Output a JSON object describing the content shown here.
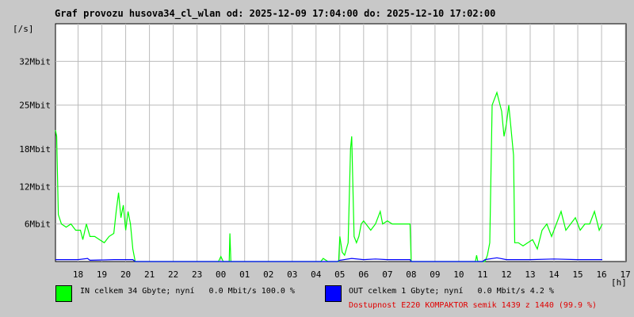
{
  "title": "Graf provozu husova34_cl_wlan od: 2025-12-09 17:04:00 do: 2025-12-10 17:02:00",
  "legend": {
    "in_label": "IN celkem 34 Gbyte; nyní   0.0 Mbit/s 100.0 %",
    "out_label": "OUT celkem 1 Gbyte; nyní   0.0 Mbit/s 4.2 %",
    "in_color": "#00ff00",
    "out_color": "#0000ff"
  },
  "availability": "Dostupnost E220 KOMPAKTOR semik 1439 z 1440 (99.9 %)",
  "chart_data": {
    "type": "line",
    "title": "Graf provozu husova34_cl_wlan od: 2025-12-09 17:04:00 do: 2025-12-10 17:02:00",
    "ylabel": "[/s]",
    "xlabel": "[h]",
    "grid": true,
    "ylim": [
      0,
      38
    ],
    "y_ticks": [
      {
        "value": 6,
        "label": "6Mbit"
      },
      {
        "value": 12,
        "label": "12Mbit"
      },
      {
        "value": 18,
        "label": "18Mbit"
      },
      {
        "value": 25,
        "label": "25Mbit"
      },
      {
        "value": 32,
        "label": "32Mbit"
      }
    ],
    "x_range": [
      17.05,
      17.03
    ],
    "x_tick_labels": [
      "18",
      "19",
      "20",
      "21",
      "22",
      "23",
      "00",
      "01",
      "02",
      "03",
      "04",
      "05",
      "06",
      "07",
      "08",
      "09",
      "10",
      "11",
      "12",
      "13",
      "14",
      "15",
      "16",
      "17"
    ],
    "series": [
      {
        "name": "IN",
        "color": "#00ff00",
        "points": [
          [
            17.05,
            21
          ],
          [
            17.1,
            20
          ],
          [
            17.17,
            7.5
          ],
          [
            17.3,
            6
          ],
          [
            17.5,
            5.5
          ],
          [
            17.7,
            6
          ],
          [
            17.9,
            5
          ],
          [
            18.1,
            5
          ],
          [
            18.2,
            3.5
          ],
          [
            18.35,
            6
          ],
          [
            18.5,
            4
          ],
          [
            18.7,
            4
          ],
          [
            18.9,
            3.5
          ],
          [
            19.1,
            3
          ],
          [
            19.3,
            4
          ],
          [
            19.5,
            4.5
          ],
          [
            19.6,
            8
          ],
          [
            19.7,
            11
          ],
          [
            19.8,
            7
          ],
          [
            19.9,
            9
          ],
          [
            20.0,
            5
          ],
          [
            20.1,
            8
          ],
          [
            20.2,
            6
          ],
          [
            20.3,
            2
          ],
          [
            20.4,
            0
          ],
          [
            21.0,
            0
          ],
          [
            22.0,
            0
          ],
          [
            23.0,
            0
          ],
          [
            23.9,
            0
          ],
          [
            24.0,
            0.8
          ],
          [
            24.1,
            0
          ],
          [
            24.35,
            0
          ],
          [
            24.38,
            4.5
          ],
          [
            24.42,
            0
          ],
          [
            25.0,
            0
          ],
          [
            27.0,
            0
          ],
          [
            28.2,
            0
          ],
          [
            28.3,
            0.5
          ],
          [
            28.5,
            0
          ],
          [
            28.95,
            0
          ],
          [
            29.0,
            4
          ],
          [
            29.1,
            1.5
          ],
          [
            29.2,
            1
          ],
          [
            29.35,
            3
          ],
          [
            29.45,
            18
          ],
          [
            29.5,
            20
          ],
          [
            29.55,
            12
          ],
          [
            29.6,
            4
          ],
          [
            29.7,
            3
          ],
          [
            29.8,
            4
          ],
          [
            29.9,
            6
          ],
          [
            30.0,
            6.5
          ],
          [
            30.1,
            6
          ],
          [
            30.3,
            5
          ],
          [
            30.5,
            6
          ],
          [
            30.7,
            8
          ],
          [
            30.8,
            6
          ],
          [
            31.0,
            6.5
          ],
          [
            31.2,
            6
          ],
          [
            31.5,
            6
          ],
          [
            31.7,
            6
          ],
          [
            31.95,
            6
          ],
          [
            32.0,
            0
          ],
          [
            33.0,
            0
          ],
          [
            34.0,
            0
          ],
          [
            34.7,
            0
          ],
          [
            34.75,
            1
          ],
          [
            34.8,
            0
          ],
          [
            35.1,
            0
          ],
          [
            35.2,
            1
          ],
          [
            35.3,
            3
          ],
          [
            35.4,
            25
          ],
          [
            35.6,
            27
          ],
          [
            35.8,
            24
          ],
          [
            35.9,
            20
          ],
          [
            36.0,
            22
          ],
          [
            36.1,
            25
          ],
          [
            36.2,
            21
          ],
          [
            36.3,
            17
          ],
          [
            36.35,
            3
          ],
          [
            36.5,
            3
          ],
          [
            36.7,
            2.5
          ],
          [
            36.9,
            3
          ],
          [
            37.1,
            3.5
          ],
          [
            37.3,
            2
          ],
          [
            37.5,
            5
          ],
          [
            37.7,
            6
          ],
          [
            37.9,
            4
          ],
          [
            38.1,
            6
          ],
          [
            38.3,
            8
          ],
          [
            38.5,
            5
          ],
          [
            38.7,
            6
          ],
          [
            38.9,
            7
          ],
          [
            39.1,
            5
          ],
          [
            39.3,
            6
          ],
          [
            39.5,
            6
          ],
          [
            39.7,
            8
          ],
          [
            39.9,
            5
          ],
          [
            40.03,
            6
          ]
        ]
      },
      {
        "name": "OUT",
        "color": "#0000ff",
        "points": [
          [
            17.05,
            0.3
          ],
          [
            18.0,
            0.3
          ],
          [
            18.4,
            0.5
          ],
          [
            18.5,
            0.2
          ],
          [
            19.5,
            0.3
          ],
          [
            20.3,
            0.3
          ],
          [
            20.4,
            0
          ],
          [
            28.9,
            0
          ],
          [
            29.0,
            0.2
          ],
          [
            29.5,
            0.5
          ],
          [
            30.0,
            0.3
          ],
          [
            30.5,
            0.4
          ],
          [
            31.0,
            0.3
          ],
          [
            31.95,
            0.3
          ],
          [
            32.0,
            0
          ],
          [
            35.0,
            0
          ],
          [
            35.1,
            0.3
          ],
          [
            35.6,
            0.6
          ],
          [
            36.0,
            0.3
          ],
          [
            37.0,
            0.3
          ],
          [
            38.0,
            0.4
          ],
          [
            39.0,
            0.3
          ],
          [
            40.03,
            0.3
          ]
        ]
      }
    ]
  }
}
